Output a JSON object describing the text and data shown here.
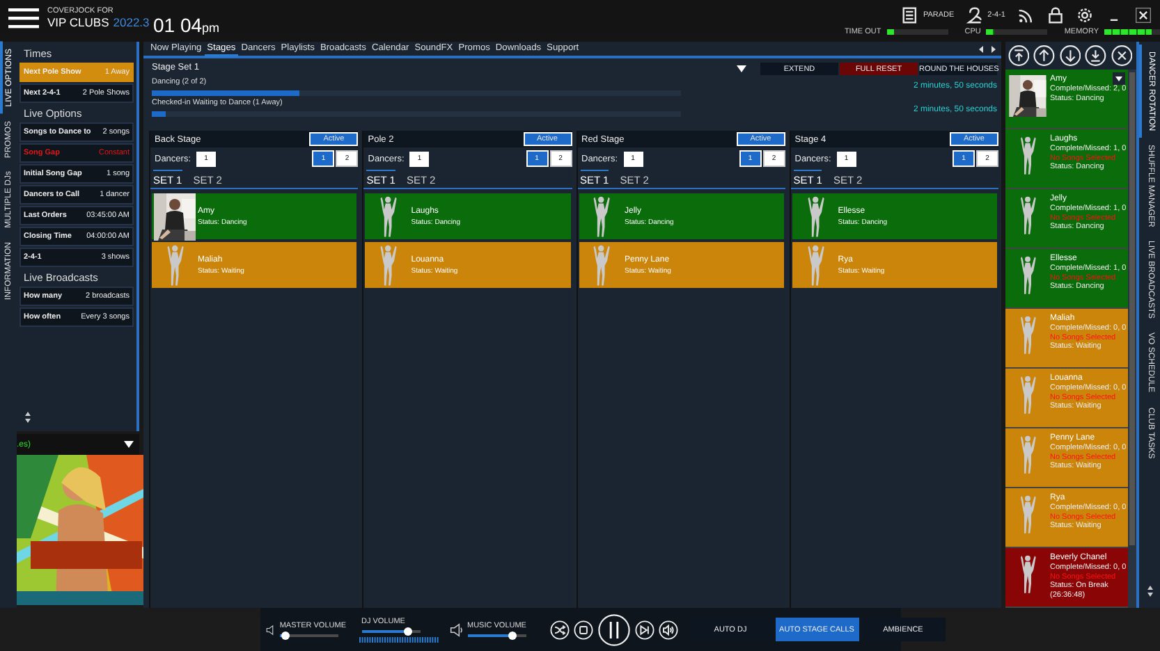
{
  "header": {
    "brand_top": "COVERJOCK FOR",
    "brand": "VIP CLUBS",
    "version": "2022.3",
    "time": "01 04",
    "meridiem": "pm"
  },
  "toolbar": [
    {
      "kind": "parade",
      "label": "PARADE"
    },
    {
      "kind": "two-for-one",
      "label": "2-4-1"
    },
    {
      "kind": "rss"
    },
    {
      "kind": "lock"
    },
    {
      "kind": "settings"
    },
    {
      "kind": "minimize"
    },
    {
      "kind": "close"
    }
  ],
  "meters": [
    {
      "label": "TIME OUT",
      "level": 0.12
    },
    {
      "label": "CPU",
      "level": 0.12
    },
    {
      "label": "MEMORY",
      "level": 0.85
    }
  ],
  "left_tabs": [
    {
      "label": "LIVE OPTIONS",
      "selected": true
    },
    {
      "label": "PROMOS",
      "selected": false
    },
    {
      "label": "MULTIPLE DJs",
      "selected": false
    },
    {
      "label": "INFORMATION",
      "selected": false
    }
  ],
  "live_options": [
    {
      "title": "Times",
      "rows": [
        {
          "label": "Next Pole Show",
          "value": "1 Away",
          "kind": "normal",
          "selected": true
        },
        {
          "label": "Next 2-4-1",
          "value": "2 Pole Shows",
          "kind": "normal",
          "selected": false
        }
      ]
    },
    {
      "title": "Live Options",
      "rows": [
        {
          "label": "Songs to Dance to",
          "value": "2 songs",
          "kind": "normal",
          "selected": false
        },
        {
          "label": "Song Gap",
          "value": "Constant",
          "kind": "warning",
          "selected": false
        },
        {
          "label": "Initial Song Gap",
          "value": "1 song",
          "kind": "normal",
          "selected": false
        },
        {
          "label": "Dancers to Call",
          "value": "1 dancer",
          "kind": "normal",
          "selected": false
        },
        {
          "label": "Last Orders",
          "value": "03:45:00 AM",
          "kind": "normal",
          "selected": false
        },
        {
          "label": "Closing Time",
          "value": "04:00:00 AM",
          "kind": "normal",
          "selected": false
        },
        {
          "label": "2-4-1",
          "value": "3 shows",
          "kind": "normal",
          "selected": false
        }
      ]
    },
    {
      "title": "Live Broadcasts",
      "rows": [
        {
          "label": "How many",
          "value": "2 broadcasts",
          "kind": "normal",
          "selected": false
        },
        {
          "label": "How often",
          "value": "Every 3 songs",
          "kind": "normal",
          "selected": false
        }
      ]
    }
  ],
  "now_playing": {
    "text": ".es)"
  },
  "tabs": [
    {
      "label": "Now Playing",
      "selected": false
    },
    {
      "label": "Stages",
      "selected": true
    },
    {
      "label": "Dancers",
      "selected": false
    },
    {
      "label": "Playlists",
      "selected": false
    },
    {
      "label": "Broadcasts",
      "selected": false
    },
    {
      "label": "Calendar",
      "selected": false
    },
    {
      "label": "SoundFX",
      "selected": false
    },
    {
      "label": "Promos",
      "selected": false
    },
    {
      "label": "Downloads",
      "selected": false
    },
    {
      "label": "Support",
      "selected": false
    }
  ],
  "stage_set": {
    "title": "Stage Set 1",
    "buttons": [
      {
        "label": "EXTEND",
        "kind": "normal"
      },
      {
        "label": "FULL RESET",
        "kind": "danger"
      },
      {
        "label": "ROUND THE HOUSES",
        "kind": "normal"
      }
    ],
    "progress": [
      {
        "label": "Dancing (2 of 2)",
        "level": 0.28,
        "time": "2 minutes, 50 seconds"
      },
      {
        "label": "Checked-in Waiting to Dance (1 Away)",
        "level": 0.026,
        "time": "2 minutes, 50 seconds"
      }
    ]
  },
  "stages": [
    {
      "name": "Back Stage",
      "status": "Active",
      "active": true,
      "dancers_label": "Dancers:",
      "dancers": "1",
      "counts": [
        {
          "label": "1",
          "selected": true
        },
        {
          "label": "2",
          "selected": false
        }
      ],
      "sets": [
        {
          "label": "SET 1",
          "selected": true
        },
        {
          "label": "SET 2",
          "selected": false
        }
      ],
      "cards": [
        {
          "name": "Amy",
          "status": "Status:  Dancing",
          "kind": "dancing",
          "photo": true
        },
        {
          "name": "Maliah",
          "status": "Status:  Waiting",
          "kind": "waiting",
          "photo": false
        }
      ]
    },
    {
      "name": "Pole 2",
      "status": "Active",
      "active": true,
      "dancers_label": "Dancers:",
      "dancers": "1",
      "counts": [
        {
          "label": "1",
          "selected": true
        },
        {
          "label": "2",
          "selected": false
        }
      ],
      "sets": [
        {
          "label": "SET 1",
          "selected": true
        },
        {
          "label": "SET 2",
          "selected": false
        }
      ],
      "cards": [
        {
          "name": "Laughs",
          "status": "Status:  Dancing",
          "kind": "dancing",
          "photo": false
        },
        {
          "name": "Louanna",
          "status": "Status:  Waiting",
          "kind": "waiting",
          "photo": false
        }
      ]
    },
    {
      "name": "Red Stage",
      "status": "Active",
      "active": true,
      "dancers_label": "Dancers:",
      "dancers": "1",
      "counts": [
        {
          "label": "1",
          "selected": true
        },
        {
          "label": "2",
          "selected": false
        }
      ],
      "sets": [
        {
          "label": "SET 1",
          "selected": true
        },
        {
          "label": "SET 2",
          "selected": false
        }
      ],
      "cards": [
        {
          "name": "Jelly",
          "status": "Status:  Dancing",
          "kind": "dancing",
          "photo": false
        },
        {
          "name": "Penny Lane",
          "status": "Status:  Waiting",
          "kind": "waiting",
          "photo": false
        }
      ]
    },
    {
      "name": "Stage 4",
      "status": "Active",
      "active": true,
      "dancers_label": "Dancers:",
      "dancers": "1",
      "counts": [
        {
          "label": "1",
          "selected": true
        },
        {
          "label": "2",
          "selected": false
        }
      ],
      "sets": [
        {
          "label": "SET 1",
          "selected": true
        },
        {
          "label": "SET 2",
          "selected": false
        }
      ],
      "cards": [
        {
          "name": "Ellesse",
          "status": "Status:  Dancing",
          "kind": "dancing",
          "photo": false
        },
        {
          "name": "Rya",
          "status": "Status:  Waiting",
          "kind": "waiting",
          "photo": false
        }
      ]
    }
  ],
  "rotation": {
    "controls": [
      {
        "kind": "move-top"
      },
      {
        "kind": "move-up"
      },
      {
        "kind": "move-down"
      },
      {
        "kind": "move-bottom"
      },
      {
        "kind": "remove"
      }
    ],
    "dancers": [
      {
        "name": "Amy",
        "counts": "Complete/Missed: 2, 0",
        "status": "Status:  Dancing",
        "kind": "dancing",
        "photo": true
      },
      {
        "name": "Laughs",
        "counts": "Complete/Missed: 1, 0",
        "warning": "No Songs Selected",
        "status": "Status:  Dancing",
        "kind": "dancing",
        "photo": false
      },
      {
        "name": "Jelly",
        "counts": "Complete/Missed: 1, 0",
        "warning": "No Songs Selected",
        "status": "Status:  Dancing",
        "kind": "dancing",
        "photo": false
      },
      {
        "name": "Ellesse",
        "counts": "Complete/Missed: 1, 0",
        "warning": "No Songs Selected",
        "status": "Status:  Dancing",
        "kind": "dancing",
        "photo": false
      },
      {
        "name": "Maliah",
        "counts": "Complete/Missed: 0, 0",
        "warning": "No Songs Selected",
        "status": "Status:  Waiting",
        "kind": "waiting",
        "photo": false
      },
      {
        "name": "Louanna",
        "counts": "Complete/Missed: 0, 0",
        "warning": "No Songs Selected",
        "status": "Status:  Waiting",
        "kind": "waiting",
        "photo": false
      },
      {
        "name": "Penny Lane",
        "counts": "Complete/Missed: 0, 0",
        "warning": "No Songs Selected",
        "status": "Status:  Waiting",
        "kind": "waiting",
        "photo": false
      },
      {
        "name": "Rya",
        "counts": "Complete/Missed: 0, 0",
        "warning": "No Songs Selected",
        "status": "Status:  Waiting",
        "kind": "waiting",
        "photo": false
      },
      {
        "name": "Beverly Chanel",
        "counts": "Complete/Missed: 0, 0",
        "warning": "No Songs Selected",
        "status": "Status:  On Break",
        "extra": "(26:36:48)",
        "kind": "break",
        "photo": false
      }
    ]
  },
  "right_tabs": [
    {
      "label": "DANCER ROTATION",
      "selected": true
    },
    {
      "label": "SHUFFLE MANAGER",
      "selected": false
    },
    {
      "label": "LIVE BROADCASTS",
      "selected": false
    },
    {
      "label": "VO SCHEDULE",
      "selected": false
    },
    {
      "label": "CLUB TASKS",
      "selected": false
    }
  ],
  "player": {
    "volumes": [
      {
        "label": "MASTER VOLUME",
        "level": 0.1
      },
      {
        "label": "DJ VOLUME",
        "level": 0.8
      },
      {
        "label": "MUSIC VOLUME",
        "level": 0.78
      }
    ],
    "transport": [
      {
        "kind": "shuffle"
      },
      {
        "kind": "stop"
      },
      {
        "kind": "pause"
      },
      {
        "kind": "next"
      },
      {
        "kind": "sound"
      }
    ],
    "modes": [
      {
        "label": "AUTO DJ",
        "on": false
      },
      {
        "label": "AUTO STAGE CALLS",
        "on": true
      },
      {
        "label": "AMBIENCE",
        "on": false
      }
    ]
  }
}
